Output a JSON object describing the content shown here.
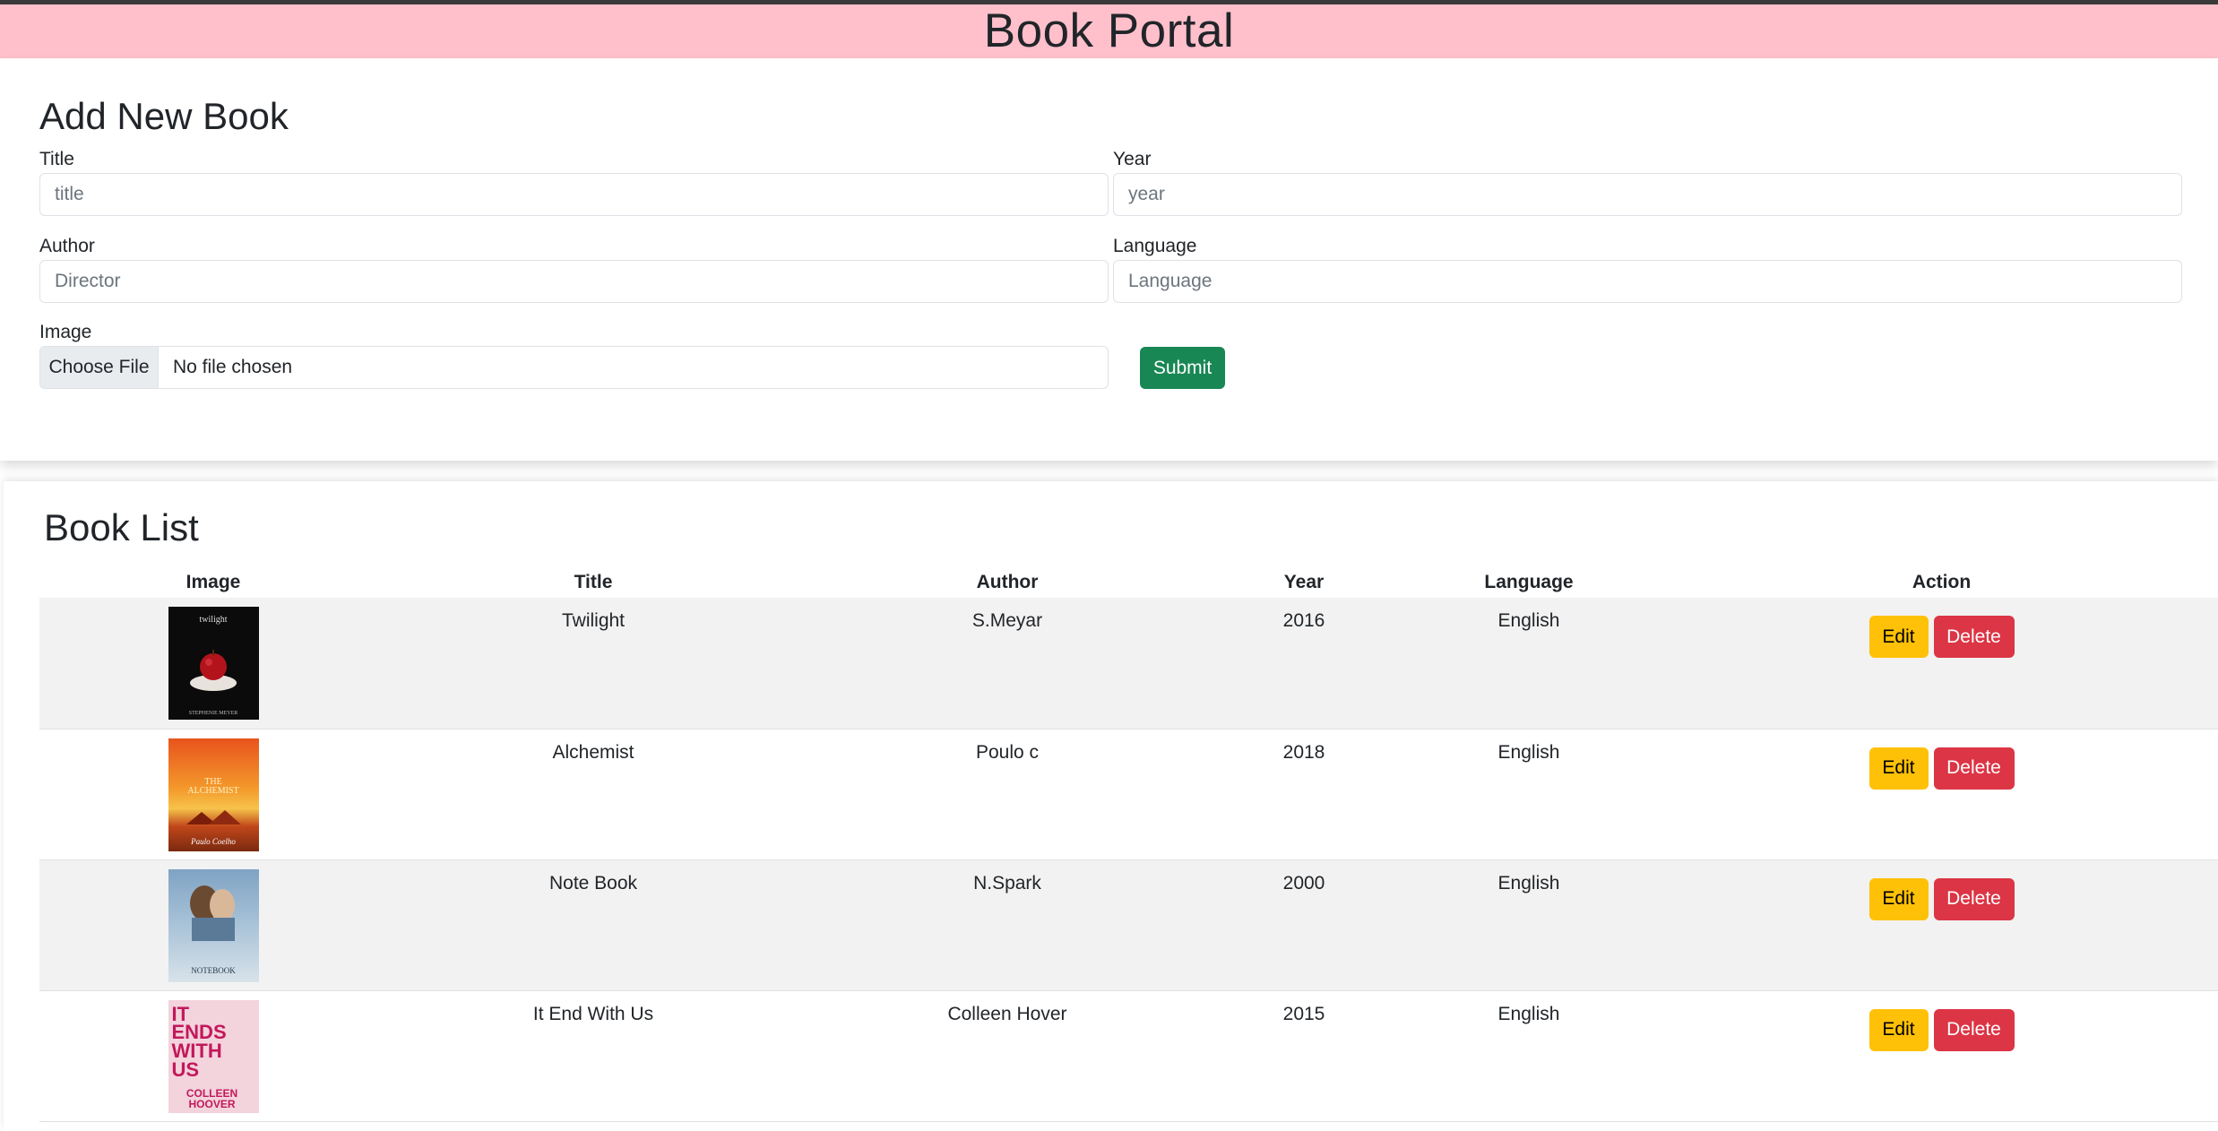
{
  "app": {
    "title": "Book Portal"
  },
  "form": {
    "heading": "Add New Book",
    "fields": {
      "title": {
        "label": "Title",
        "placeholder": "title",
        "value": ""
      },
      "year": {
        "label": "Year",
        "placeholder": "year",
        "value": ""
      },
      "author": {
        "label": "Author",
        "placeholder": "Director",
        "value": ""
      },
      "language": {
        "label": "Language",
        "placeholder": "Language",
        "value": ""
      },
      "image": {
        "label": "Image",
        "button_label": "Choose File",
        "status": "No file chosen"
      }
    },
    "submit_label": "Submit",
    "submit_color": "#198754"
  },
  "list": {
    "heading": "Book List",
    "columns": [
      "Image",
      "Title",
      "Author",
      "Year",
      "Language",
      "Action"
    ],
    "edit_label": "Edit",
    "delete_label": "Delete",
    "edit_color": "#ffc107",
    "delete_color": "#dc3545",
    "books": [
      {
        "title": "Twilight",
        "author": "S.Meyar",
        "year": "2016",
        "language": "English",
        "cover": {
          "icon": "apple-in-hands-cover",
          "text": "twilight",
          "byline": "STEPHENIE MEYER"
        }
      },
      {
        "title": "Alchemist",
        "author": "Poulo c",
        "year": "2018",
        "language": "English",
        "cover": {
          "icon": "desert-sunset-cover",
          "text": "THE ALCHEMIST",
          "byline": "Paulo Coelho"
        }
      },
      {
        "title": "Note Book",
        "author": "N.Spark",
        "year": "2000",
        "language": "English",
        "cover": {
          "icon": "couple-kissing-cover",
          "text": "NOTEBOOK",
          "byline": ""
        }
      },
      {
        "title": "It End With Us",
        "author": "Colleen Hover",
        "year": "2015",
        "language": "English",
        "cover": {
          "icon": "pink-flowers-cover",
          "text": "IT ENDS WITH US",
          "byline": "COLLEEN HOOVER"
        }
      }
    ]
  },
  "colors": {
    "header_bg": "#ffc0cb"
  }
}
